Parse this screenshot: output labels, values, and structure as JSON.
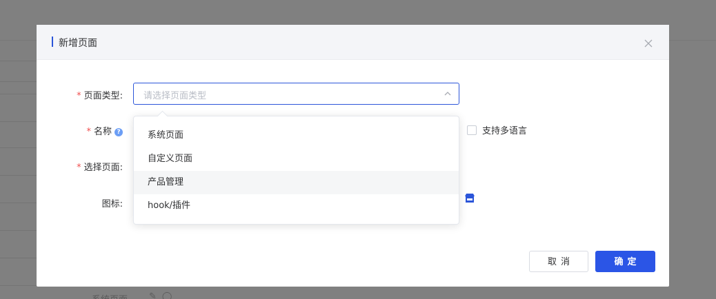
{
  "background": {
    "bottom_text": "系统页面"
  },
  "modal": {
    "title": "新增页面",
    "accent_color": "#2b55d9",
    "close_icon": "close-icon"
  },
  "form": {
    "page_type": {
      "label": "页面类型:",
      "required": "*",
      "placeholder": "请选择页面类型"
    },
    "name": {
      "label": "名称",
      "required": "*",
      "help_icon": "?"
    },
    "multilang": {
      "label": "支持多语言",
      "checked": false
    },
    "select_page": {
      "label": "选择页面:",
      "required": "*"
    },
    "icon": {
      "label": "图标:",
      "icon_name": "store-icon"
    }
  },
  "dropdown": {
    "options": [
      {
        "label": "系统页面"
      },
      {
        "label": "自定义页面"
      },
      {
        "label": "产品管理"
      },
      {
        "label": "hook/插件"
      }
    ],
    "hovered_index": 2
  },
  "footer": {
    "cancel_label": "取消",
    "confirm_label": "确定",
    "primary_color": "#2b55e6"
  }
}
